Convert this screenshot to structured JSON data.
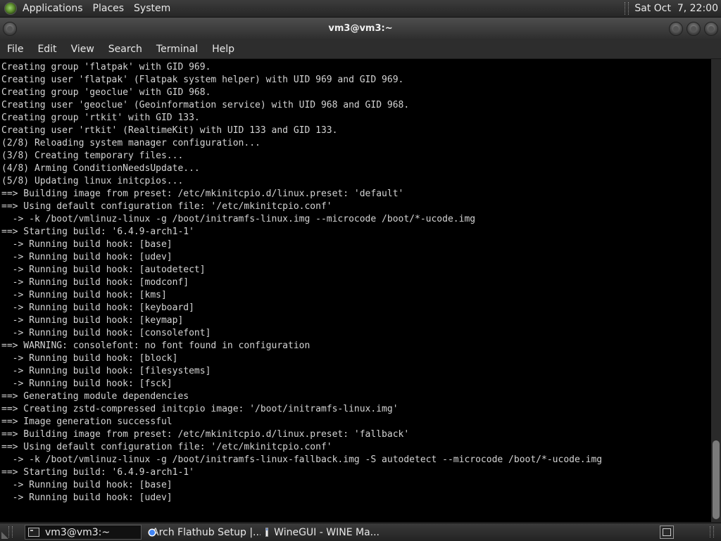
{
  "top_panel": {
    "logo_icon": "distro-logo-icon",
    "menus": [
      "Applications",
      "Places",
      "System"
    ],
    "clock": "Sat Oct  7, 22:00"
  },
  "window": {
    "title": "vm3@vm3:~",
    "buttons": [
      "minimize-button",
      "maximize-button",
      "close-button"
    ]
  },
  "menubar": {
    "items": [
      "File",
      "Edit",
      "View",
      "Search",
      "Terminal",
      "Help"
    ]
  },
  "terminal": {
    "lines": [
      "Creating group 'flatpak' with GID 969.",
      "Creating user 'flatpak' (Flatpak system helper) with UID 969 and GID 969.",
      "Creating group 'geoclue' with GID 968.",
      "Creating user 'geoclue' (Geoinformation service) with UID 968 and GID 968.",
      "Creating group 'rtkit' with GID 133.",
      "Creating user 'rtkit' (RealtimeKit) with UID 133 and GID 133.",
      "(2/8) Reloading system manager configuration...",
      "(3/8) Creating temporary files...",
      "(4/8) Arming ConditionNeedsUpdate...",
      "(5/8) Updating linux initcpios...",
      "==> Building image from preset: /etc/mkinitcpio.d/linux.preset: 'default'",
      "==> Using default configuration file: '/etc/mkinitcpio.conf'",
      "  -> -k /boot/vmlinuz-linux -g /boot/initramfs-linux.img --microcode /boot/*-ucode.img",
      "==> Starting build: '6.4.9-arch1-1'",
      "  -> Running build hook: [base]",
      "  -> Running build hook: [udev]",
      "  -> Running build hook: [autodetect]",
      "  -> Running build hook: [modconf]",
      "  -> Running build hook: [kms]",
      "  -> Running build hook: [keyboard]",
      "  -> Running build hook: [keymap]",
      "  -> Running build hook: [consolefont]",
      "==> WARNING: consolefont: no font found in configuration",
      "  -> Running build hook: [block]",
      "  -> Running build hook: [filesystems]",
      "  -> Running build hook: [fsck]",
      "==> Generating module dependencies",
      "==> Creating zstd-compressed initcpio image: '/boot/initramfs-linux.img'",
      "==> Image generation successful",
      "==> Building image from preset: /etc/mkinitcpio.d/linux.preset: 'fallback'",
      "==> Using default configuration file: '/etc/mkinitcpio.conf'",
      "  -> -k /boot/vmlinuz-linux -g /boot/initramfs-linux-fallback.img -S autodetect --microcode /boot/*-ucode.img",
      "==> Starting build: '6.4.9-arch1-1'",
      "  -> Running build hook: [base]",
      "  -> Running build hook: [udev]"
    ]
  },
  "taskbar": {
    "tasks": [
      {
        "label": "vm3@vm3:~",
        "icon": "terminal-icon",
        "active": true
      },
      {
        "label": "Arch Flathub Setup |...",
        "icon": "chrome-icon",
        "active": false
      },
      {
        "label": "WineGUI - WINE Ma...",
        "icon": "wine-window-icon",
        "active": false
      }
    ],
    "show_desktop_icon": "show-desktop-icon"
  }
}
